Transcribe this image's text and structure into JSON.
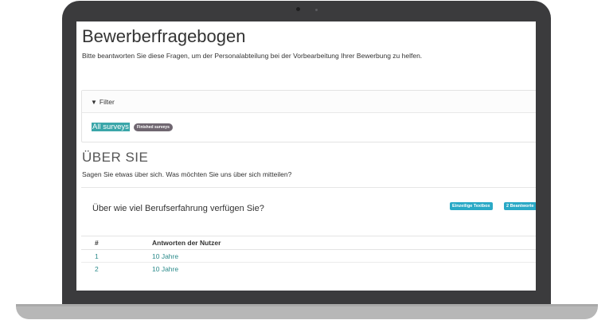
{
  "page": {
    "title": "Bewerberfragebogen",
    "subtitle": "Bitte beantworten Sie diese Fragen, um der Personalabteilung bei der Vorbearbeitung Ihrer Bewerbung zu helfen."
  },
  "filter": {
    "label": "Filter",
    "tags": {
      "all": "All surveys",
      "finished": "Finished surveys"
    }
  },
  "section": {
    "title": "ÜBER SIE",
    "subtitle": "Sagen Sie etwas über sich. Was möchten Sie uns über sich mitteilen?"
  },
  "question": {
    "text": "Über wie viel Berufserfahrung verfügen Sie?",
    "badge_type": "Einzeilige Textbox",
    "badge_count": "2 Beantworte"
  },
  "table": {
    "headers": [
      "#",
      "Antworten der Nutzer"
    ],
    "rows": [
      [
        "1",
        "10 Jahre"
      ],
      [
        "2",
        "10 Jahre"
      ]
    ]
  },
  "colors": {
    "accent_teal": "#3aa6a9",
    "badge_blue": "#2aa9c6",
    "tag_dark": "#6f6670",
    "laptop_frame": "#3b3b3d"
  },
  "icons": {
    "filter": "funnel-icon"
  }
}
